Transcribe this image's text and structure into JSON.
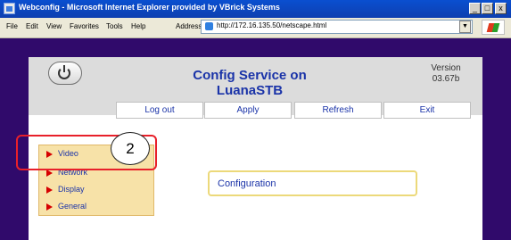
{
  "window": {
    "title": "Webconfig - Microsoft Internet Explorer provided by VBrick Systems",
    "min_label": "_",
    "max_label": "□",
    "close_label": "x"
  },
  "menu": [
    "File",
    "Edit",
    "View",
    "Favorites",
    "Tools",
    "Help"
  ],
  "address": {
    "label": "Address",
    "url": "http://172.16.135.50/netscape.html",
    "go_label": "▼"
  },
  "page": {
    "title_line1": "Config Service on",
    "title_line2": "LuanaSTB",
    "version_label": "Version",
    "version_value": "03.67b",
    "nav": [
      "Log out",
      "Apply",
      "Refresh",
      "Exit"
    ],
    "sidebar": [
      "Video",
      "Network",
      "Display",
      "General"
    ],
    "content_label": "Configuration"
  },
  "annotation": {
    "callout": "2"
  },
  "colors": {
    "frame": "#300a6b",
    "header_text": "#1a33a8",
    "highlight": "#e8202a",
    "sidebar_bg": "#f7e2a8"
  }
}
